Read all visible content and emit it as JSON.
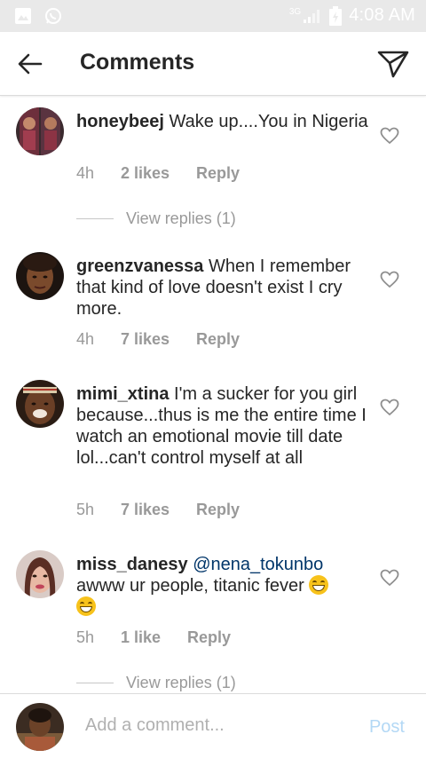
{
  "status_bar": {
    "network": "3G",
    "time": "4:08 AM"
  },
  "header": {
    "title": "Comments",
    "back_icon": "arrow-left-icon",
    "send_icon": "paper-plane-icon"
  },
  "comments": [
    {
      "username": "honeybeej",
      "mention": "",
      "text": "Wake up....You in Nigeria",
      "time": "4h",
      "likes": "2 likes",
      "reply": "Reply",
      "view_replies": "View replies (1)"
    },
    {
      "username": "greenzvanessa",
      "mention": "",
      "text": "When I remember that kind of love doesn't exist I cry more.",
      "time": "4h",
      "likes": "7 likes",
      "reply": "Reply"
    },
    {
      "username": "mimi_xtina",
      "mention": "",
      "text": "I'm a sucker for you girl because...thus is me the entire time I watch an emotional movie till date lol...can't control myself at all",
      "time": "5h",
      "likes": "7 likes",
      "reply": "Reply"
    },
    {
      "username": "miss_danesy",
      "mention": "@nena_tokunbo",
      "text": "awww ur people, titanic fever",
      "time": "5h",
      "likes": "1 like",
      "reply": "Reply",
      "view_replies": "View replies (1)"
    }
  ],
  "footer": {
    "placeholder": "Add a comment...",
    "post_label": "Post"
  },
  "colors": {
    "accent_disabled": "#b3d8f5",
    "mention": "#003569",
    "meta": "#999999"
  }
}
